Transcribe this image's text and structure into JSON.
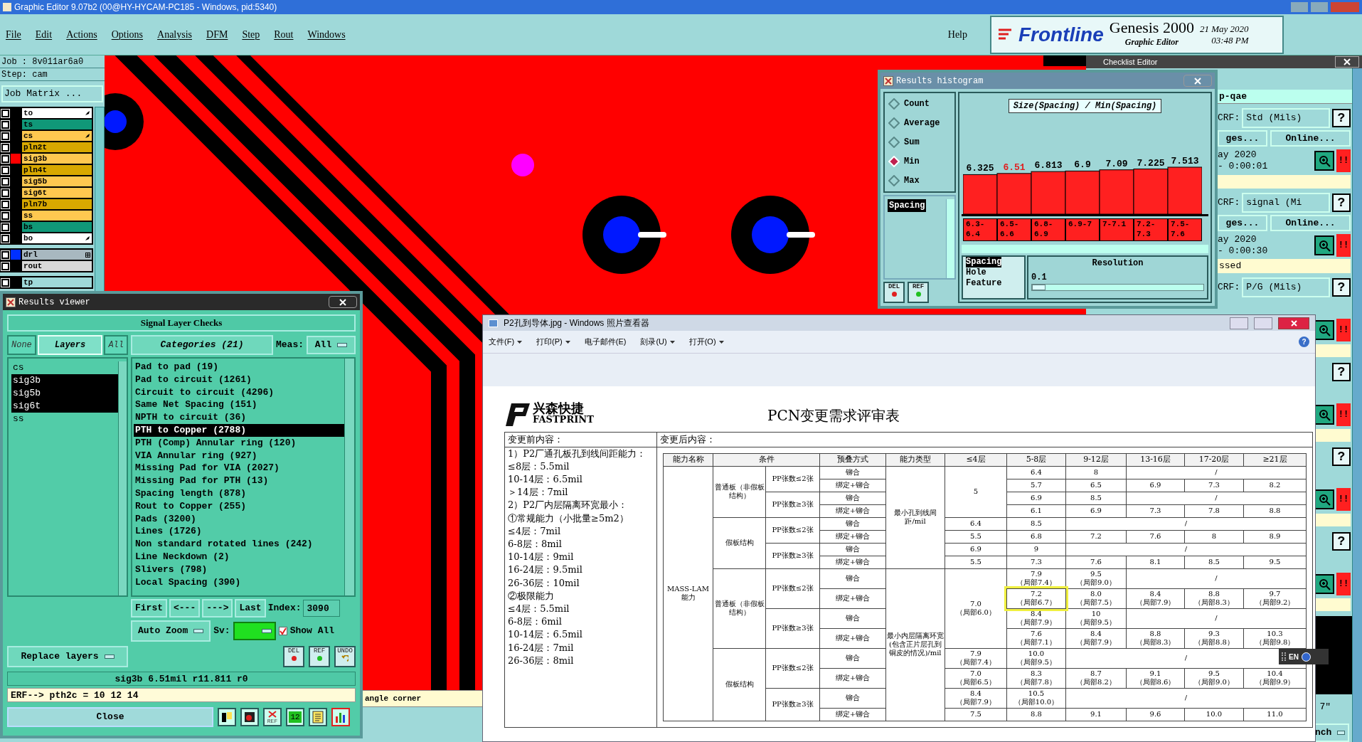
{
  "window": {
    "title": "Graphic Editor 9.07b2 (00@HY-HYCAM-PC185 - Windows, pid:5340)"
  },
  "menu": [
    "File",
    "Edit",
    "Actions",
    "Options",
    "Analysis",
    "DFM",
    "Step",
    "Rout",
    "Windows"
  ],
  "help": "Help",
  "brand": {
    "logo": "Frontline",
    "product": "Genesis 2000",
    "subtitle": "Graphic Editor",
    "date": "21 May 2020",
    "time": "03:48 PM"
  },
  "job": {
    "job": "Job : 8v011ar6a0",
    "step": "Step: cam",
    "matrix_button": "Job Matrix ..."
  },
  "layer_groups": [
    [
      {
        "name": "to",
        "kind": "misc",
        "pointer": true,
        "checked": false
      },
      {
        "name": "ts",
        "kind": "mask",
        "pointer": false,
        "checked": false
      },
      {
        "name": "cs",
        "kind": "signal",
        "pointer": true,
        "checked": false
      },
      {
        "name": "pln2t",
        "kind": "plane",
        "pointer": false,
        "checked": false
      },
      {
        "name": "sig3b",
        "kind": "signal",
        "pointer": false,
        "checked": false,
        "color": "#ff0000"
      },
      {
        "name": "pln4t",
        "kind": "plane",
        "pointer": false,
        "checked": false
      },
      {
        "name": "sig5b",
        "kind": "signal",
        "pointer": false,
        "checked": false
      },
      {
        "name": "sig6t",
        "kind": "signal",
        "pointer": false,
        "checked": false
      },
      {
        "name": "pln7b",
        "kind": "plane",
        "pointer": false,
        "checked": false
      },
      {
        "name": "ss",
        "kind": "signal",
        "pointer": false,
        "checked": false
      },
      {
        "name": "bs",
        "kind": "mask",
        "pointer": false,
        "checked": false
      },
      {
        "name": "bo",
        "kind": "misc",
        "pointer": true,
        "checked": false
      }
    ],
    [
      {
        "name": "drl",
        "kind": "drill",
        "pointer": false,
        "checked": false,
        "color": "#0030ff"
      },
      {
        "name": "rout",
        "kind": "rout",
        "pointer": false,
        "checked": false
      }
    ],
    [
      {
        "name": "tp",
        "kind": "document",
        "pointer": false,
        "checked": false
      }
    ]
  ],
  "status_strip": "angle corner",
  "results_viewer": {
    "title": "Results viewer",
    "heading": "Signal Layer Checks",
    "layer_buttons": [
      {
        "label": "None",
        "selected": false
      },
      {
        "label": "Layers",
        "selected": true
      },
      {
        "label": "All",
        "selected": false
      }
    ],
    "layers": [
      {
        "name": "cs",
        "selected": false
      },
      {
        "name": "sig3b",
        "selected": true
      },
      {
        "name": "sig5b",
        "selected": true
      },
      {
        "name": "sig6t",
        "selected": true
      },
      {
        "name": "ss",
        "selected": false
      }
    ],
    "categories_button": "Categories (21)",
    "meas_label": "Meas:",
    "meas_value": "All",
    "categories": [
      {
        "name": "Pad to pad (19)",
        "selected": false
      },
      {
        "name": "Pad to circuit (1261)",
        "selected": false
      },
      {
        "name": "Circuit to circuit (4296)",
        "selected": false
      },
      {
        "name": "Same Net Spacing (151)",
        "selected": false
      },
      {
        "name": "NPTH to circuit (36)",
        "selected": false
      },
      {
        "name": "PTH to Copper (2788)",
        "selected": true
      },
      {
        "name": "PTH (Comp) Annular ring (120)",
        "selected": false
      },
      {
        "name": "VIA Annular ring (927)",
        "selected": false
      },
      {
        "name": "Missing Pad for VIA (2027)",
        "selected": false
      },
      {
        "name": "Missing Pad for PTH (13)",
        "selected": false
      },
      {
        "name": "Spacing length (878)",
        "selected": false
      },
      {
        "name": "Rout to Copper (255)",
        "selected": false
      },
      {
        "name": "Pads (3200)",
        "selected": false
      },
      {
        "name": "Lines (1726)",
        "selected": false
      },
      {
        "name": "Non standard rotated lines (242)",
        "selected": false
      },
      {
        "name": "Line Neckdown (2)",
        "selected": false
      },
      {
        "name": "Slivers (798)",
        "selected": false
      },
      {
        "name": "Local Spacing (390)",
        "selected": false
      }
    ],
    "nav": [
      "First",
      "<---",
      "--->",
      "Last"
    ],
    "index_label": "Index:",
    "index_value": "3090",
    "zoom_mode": "Auto Zoom",
    "sv_label": "Sv:",
    "show_all": {
      "label": "Show All",
      "checked": true
    },
    "replace": "Replace layers",
    "actions": [
      {
        "kind": "del",
        "label": "DEL"
      },
      {
        "kind": "ref",
        "label": "REF"
      },
      {
        "kind": "undo",
        "label": "UNDO"
      }
    ],
    "status": "sig3b 6.51mil r11.811 r0",
    "erf": "ERF--> pth2c = 10 12 14",
    "close": "Close",
    "tools": [
      {
        "kind": "layers",
        "selected": false
      },
      {
        "kind": "record",
        "selected": false
      },
      {
        "kind": "ref-crossed",
        "label": "REF",
        "selected": false
      },
      {
        "kind": "numbers",
        "label": "12",
        "selected": false
      },
      {
        "kind": "report",
        "selected": false
      },
      {
        "kind": "histogram",
        "selected": true
      }
    ]
  },
  "histogram": {
    "title": "Results histogram",
    "modes": [
      {
        "label": "Count",
        "selected": false
      },
      {
        "label": "Average",
        "selected": false
      },
      {
        "label": "Sum",
        "selected": false
      },
      {
        "label": "Min",
        "selected": true
      },
      {
        "label": "Max",
        "selected": false
      }
    ],
    "attributes": [
      {
        "label": "Spacing",
        "selected": true
      }
    ],
    "chart_title": "Size(Spacing) / Min(Spacing)",
    "chart_data": {
      "type": "bar",
      "categories": [
        "6.3-6.4",
        "6.5-6.6",
        "6.8-6.9",
        "6.9-7",
        "7-7.1",
        "7.2-7.3",
        "7.5-7.6"
      ],
      "values": [
        6.325,
        6.51,
        6.813,
        6.9,
        7.09,
        7.225,
        7.513
      ],
      "data_labels": true
    },
    "bins": [
      {
        "selected": false
      },
      {
        "selected": true
      },
      {
        "selected": false
      },
      {
        "selected": false
      },
      {
        "selected": false
      },
      {
        "selected": false
      },
      {
        "selected": false
      }
    ],
    "buttons": [
      {
        "kind": "del",
        "label": "DEL"
      },
      {
        "kind": "ref",
        "label": "REF"
      }
    ],
    "types": [
      {
        "label": "Spacing",
        "selected": true
      },
      {
        "label": "Hole",
        "selected": false
      },
      {
        "label": "Feature",
        "selected": false
      }
    ],
    "resolution_label": "Resolution",
    "resolution_value": "0.1",
    "resolution": {
      "level": 0.08
    }
  },
  "checklist": {
    "title": "Checklist Editor",
    "name": "p-qae",
    "blocks": [
      {
        "erf_label": "CRF:",
        "erf_value": "Std (Mils)",
        "help": "?",
        "ranges": "ges...",
        "online": "Online...",
        "date": "ay 2020",
        "duration": "- 0:00:01",
        "alert": "!!"
      },
      {
        "erf_label": "CRF:",
        "erf_value": "signal (Mi",
        "help": "?",
        "ranges": "ges...",
        "online": "Online...",
        "date": "ay 2020",
        "duration": "- 0:00:30",
        "alert": "!!",
        "status": "ssed"
      },
      {
        "erf_label": "CRF:",
        "erf_value": "P/G (Mils)",
        "help": "?",
        "alert": "!!"
      },
      {
        "help": "?",
        "alert": "!!"
      },
      {
        "help": "?",
        "alert": "!!"
      },
      {
        "help": "?",
        "alert": "!!"
      }
    ],
    "footer_value": "7\"",
    "footer_dropdown": "nch"
  },
  "photo_viewer": {
    "title": "P2孔到导体.jpg - Windows 照片查看器",
    "help": "?",
    "menu": [
      {
        "label": "文件(F)",
        "dropdown": true
      },
      {
        "label": "打印(P)",
        "dropdown": true
      },
      {
        "label": "电子邮件(E)",
        "dropdown": false
      },
      {
        "label": "刻录(U)",
        "dropdown": true
      },
      {
        "label": "打开(O)",
        "dropdown": true
      }
    ],
    "document": {
      "company": "兴森快捷",
      "company_en": "FASTPRINT",
      "title": "PCN变更需求评审表",
      "before_label": "变更前内容：",
      "after_label": "变更后内容：",
      "before_lines": [
        "1）P2厂通孔板孔到线间距能力：",
        "≤8层：5.5mil",
        "10-14层：6.5mil",
        "＞14层：7mil",
        "2）P2厂内层隔离环宽最小：",
        "①常规能力（小批量≥5m2）",
        "≤4层：7mil",
        "6-8层：8mil",
        "10-14层：9mil",
        "16-24层：9.5mil",
        "26-36层：10mil",
        "②极限能力",
        "≤4层：5.5mil",
        "6-8层：6mil",
        "10-14层：6.5mil",
        "16-24层：7mil",
        "26-36层：8mil"
      ],
      "columns": [
        {
          "text": "能力名称"
        },
        {
          "text": "条件",
          "colspan": 2
        },
        {
          "text": "预叠方式"
        },
        {
          "text": "能力类型"
        },
        {
          "text": "≤4层"
        },
        {
          "text": "5-8层"
        },
        {
          "text": "9-12层"
        },
        {
          "text": "13-16层"
        },
        {
          "text": "17-20层"
        },
        {
          "text": "≥21层"
        }
      ],
      "rows": [
        [
          {
            "text": "MASS-LAM能力",
            "rowspan": 16
          },
          {
            "text": "普通板（非假板结构）",
            "rowspan": 4
          },
          {
            "text": "PP张数≤2张",
            "rowspan": 2
          },
          {
            "text": "铆合"
          },
          {
            "text": "最小孔到线间距/mil",
            "rowspan": 8
          },
          {
            "text": "5",
            "rowspan": 4
          },
          {
            "text": "6.4"
          },
          {
            "text": "8"
          },
          {
            "text": "/",
            "colspan": 3
          }
        ],
        [
          {
            "text": "绑定+铆合"
          },
          {
            "text": "5.7"
          },
          {
            "text": "6.5"
          },
          {
            "text": "6.9"
          },
          {
            "text": "7.3"
          },
          {
            "text": "8.2"
          }
        ],
        [
          {
            "text": "PP张数≥3张",
            "rowspan": 2
          },
          {
            "text": "铆合"
          },
          {
            "text": "6.9"
          },
          {
            "text": "8.5"
          },
          {
            "text": "/",
            "colspan": 3
          }
        ],
        [
          {
            "text": "绑定+铆合"
          },
          {
            "text": "6.1"
          },
          {
            "text": "6.9"
          },
          {
            "text": "7.3"
          },
          {
            "text": "7.8"
          },
          {
            "text": "8.8"
          }
        ],
        [
          {
            "text": "假板结构",
            "rowspan": 4
          },
          {
            "text": "PP张数≤2张",
            "rowspan": 2
          },
          {
            "text": "铆合"
          },
          {
            "text": "6.4"
          },
          {
            "text": "8.5"
          },
          {
            "text": "/",
            "colspan": 4
          }
        ],
        [
          {
            "text": "绑定+铆合"
          },
          {
            "text": "5.5"
          },
          {
            "text": "6.8"
          },
          {
            "text": "7.2"
          },
          {
            "text": "7.6"
          },
          {
            "text": "8"
          },
          {
            "text": "8.9"
          }
        ],
        [
          {
            "text": "PP张数≥3张",
            "rowspan": 2
          },
          {
            "text": "铆合"
          },
          {
            "text": "6.9"
          },
          {
            "text": "9"
          },
          {
            "text": "/",
            "colspan": 4
          }
        ],
        [
          {
            "text": "绑定+铆合"
          },
          {
            "text": "5.5"
          },
          {
            "text": "7.3"
          },
          {
            "text": "7.6"
          },
          {
            "text": "8.1"
          },
          {
            "text": "8.5"
          },
          {
            "text": "9.5"
          }
        ],
        [
          {
            "text": "普通板（非假板结构）",
            "rowspan": 4
          },
          {
            "text": "PP张数≤2张",
            "rowspan": 2
          },
          {
            "text": "铆合"
          },
          {
            "text": "最小内层隔离环宽(包含正片层孔到铜皮的情况)/mil",
            "rowspan": 8
          },
          {
            "text": "7.0",
            "note": "（局部6.0）",
            "rowspan": 4
          },
          {
            "text": "7.9",
            "note": "（局部7.4）"
          },
          {
            "text": "9.5",
            "note": "（局部9.0）"
          },
          {
            "text": "/",
            "colspan": 3
          }
        ],
        [
          {
            "text": "绑定+铆合"
          },
          {
            "text": "7.2",
            "note": "（局部6.7）",
            "highlighted": true
          },
          {
            "text": "8.0",
            "note": "（局部7.5）"
          },
          {
            "text": "8.4",
            "note": "（局部7.9）"
          },
          {
            "text": "8.8",
            "note": "（局部8.3）"
          },
          {
            "text": "9.7",
            "note": "（局部9.2）"
          }
        ],
        [
          {
            "text": "PP张数≥3张",
            "rowspan": 2
          },
          {
            "text": "铆合"
          },
          {
            "text": "8.4",
            "note": "（局部7.9）"
          },
          {
            "text": "10",
            "note": "（局部9.5）"
          },
          {
            "text": "/",
            "colspan": 3
          }
        ],
        [
          {
            "text": "绑定+铆合"
          },
          {
            "text": "7.6",
            "note": "（局部7.1）"
          },
          {
            "text": "8.4",
            "note": "（局部7.9）"
          },
          {
            "text": "8.8",
            "note": "（局部8.3）"
          },
          {
            "text": "9.3",
            "note": "（局部8.8）"
          },
          {
            "text": "10.3",
            "note": "（局部9.8）"
          }
        ],
        [
          {
            "text": "假板结构",
            "rowspan": 4
          },
          {
            "text": "PP张数≤2张",
            "rowspan": 2
          },
          {
            "text": "铆合"
          },
          {
            "text": "7.9",
            "note": "（局部7.4）"
          },
          {
            "text": "10.0",
            "note": "（局部9.5）"
          },
          {
            "text": "/",
            "colspan": 4
          }
        ],
        [
          {
            "text": "绑定+铆合"
          },
          {
            "text": "7.0",
            "note": "（局部6.5）"
          },
          {
            "text": "8.3",
            "note": "（局部7.8）"
          },
          {
            "text": "8.7",
            "note": "（局部8.2）"
          },
          {
            "text": "9.1",
            "note": "（局部8.6）"
          },
          {
            "text": "9.5",
            "note": "（局部9.0）"
          },
          {
            "text": "10.4",
            "note": "（局部9.9）"
          }
        ],
        [
          {
            "text": "PP张数≥3张",
            "rowspan": 2
          },
          {
            "text": "铆合"
          },
          {
            "text": "8.4",
            "note": "（局部7.9）"
          },
          {
            "text": "10.5",
            "note": "（局部10.0）"
          },
          {
            "text": "/",
            "colspan": 4
          }
        ],
        [
          {
            "text": "绑定+铆合"
          },
          {
            "text": "7.5"
          },
          {
            "text": "8.8"
          },
          {
            "text": "9.1"
          },
          {
            "text": "9.6"
          },
          {
            "text": "10.0"
          },
          {
            "text": "11.0"
          }
        ]
      ]
    }
  },
  "language_bar": "EN"
}
